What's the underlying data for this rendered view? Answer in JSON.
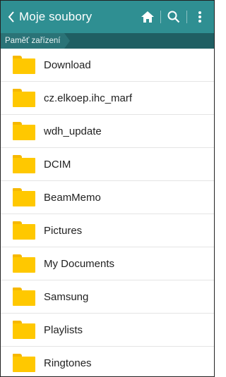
{
  "header": {
    "title": "Moje soubory",
    "accent": "#2f8f92",
    "icons": [
      "back-arrow-icon",
      "home-icon",
      "search-icon",
      "more-vert-icon"
    ]
  },
  "breadcrumb": {
    "items": [
      "Paměť zařízení"
    ]
  },
  "folders": [
    {
      "name": "Download"
    },
    {
      "name": "cz.elkoep.ihc_marf"
    },
    {
      "name": "wdh_update"
    },
    {
      "name": "DCIM"
    },
    {
      "name": "BeamMemo"
    },
    {
      "name": "Pictures"
    },
    {
      "name": "My Documents"
    },
    {
      "name": "Samsung"
    },
    {
      "name": "Playlists"
    },
    {
      "name": "Ringtones"
    }
  ],
  "colors": {
    "folder": "#ffc800",
    "breadcrumb_bg": "#1f5f63"
  }
}
